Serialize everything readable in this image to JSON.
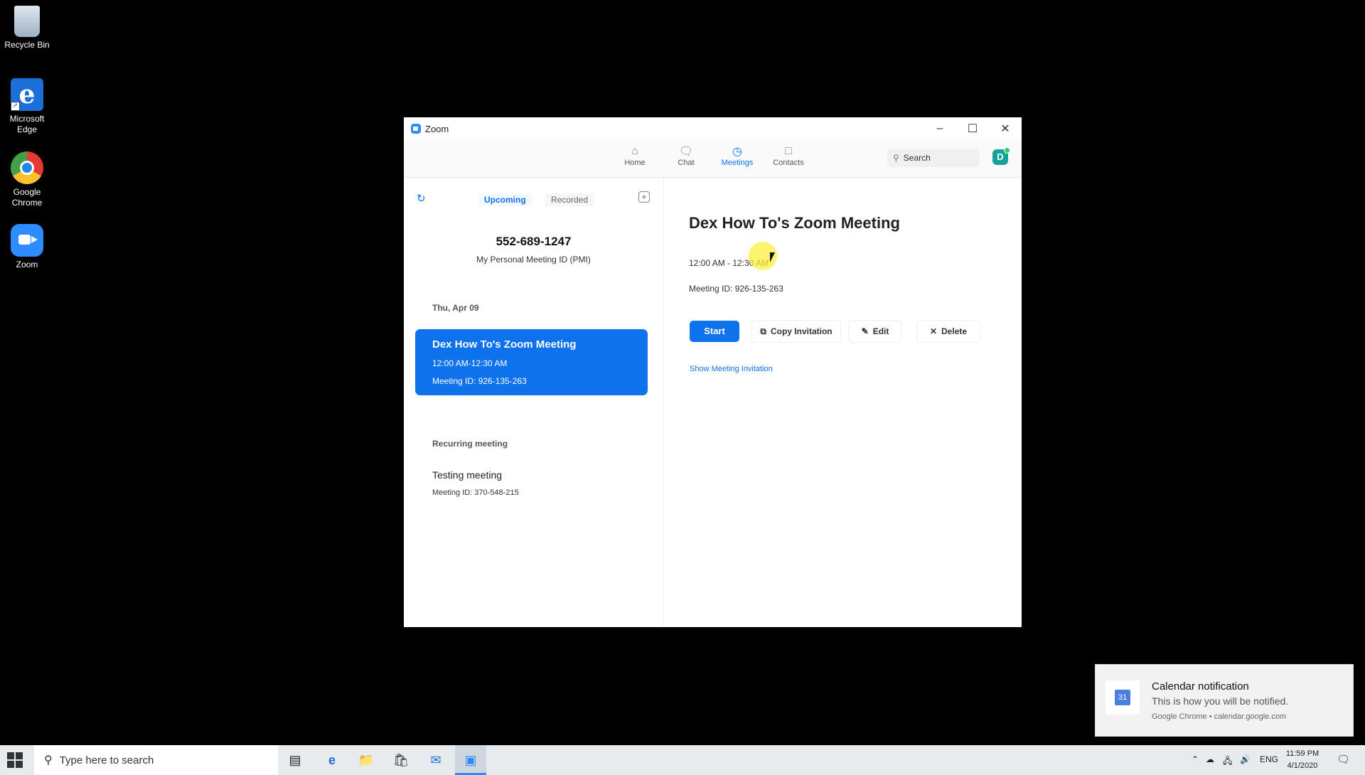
{
  "desktop": {
    "icons": [
      {
        "label": "Recycle Bin",
        "icon": "recycle-bin-icon"
      },
      {
        "label": "Microsoft Edge",
        "icon": "edge-icon"
      },
      {
        "label": "Google Chrome",
        "icon": "chrome-icon"
      },
      {
        "label": "Zoom",
        "icon": "zoom-icon"
      }
    ]
  },
  "zoom": {
    "window_title": "Zoom",
    "nav": {
      "tabs": [
        {
          "label": "Home",
          "icon": "home-icon"
        },
        {
          "label": "Chat",
          "icon": "chat-icon"
        },
        {
          "label": "Meetings",
          "icon": "clock-icon",
          "active": true
        },
        {
          "label": "Contacts",
          "icon": "contacts-icon"
        }
      ],
      "search_placeholder": "Search",
      "avatar_initial": "D"
    },
    "left": {
      "subtabs": [
        "Upcoming",
        "Recorded"
      ],
      "pmi_number": "552-689-1247",
      "pmi_label": "My Personal Meeting ID (PMI)",
      "date_heading": "Thu, Apr 09",
      "selected_meeting": {
        "title": "Dex How To's Zoom Meeting",
        "time": "12:00 AM-12:30 AM",
        "meeting_id": "Meeting ID: 926-135-263"
      },
      "recurring_heading": "Recurring meeting",
      "recurring_meeting": {
        "title": "Testing meeting",
        "meeting_id": "Meeting ID: 370-548-215"
      }
    },
    "detail": {
      "title": "Dex How To's Zoom Meeting",
      "time": "12:00 AM - 12:30 AM",
      "meeting_id": "Meeting ID: 926-135-263",
      "buttons": {
        "start": "Start",
        "copy_invitation": "Copy Invitation",
        "edit": "Edit",
        "delete": "Delete"
      },
      "show_invitation": "Show Meeting Invitation"
    }
  },
  "notification": {
    "title": "Calendar notification",
    "body": "This is how you will be notified.",
    "source": "Google Chrome • calendar.google.com"
  },
  "taskbar": {
    "search_placeholder": "Type here to search",
    "language": "ENG",
    "time": "11:59 PM",
    "date": "4/1/2020"
  },
  "colors": {
    "zoom_blue": "#0e72ed",
    "desktop_bg": "#000000",
    "taskbar_bg": "#e8ebee"
  }
}
